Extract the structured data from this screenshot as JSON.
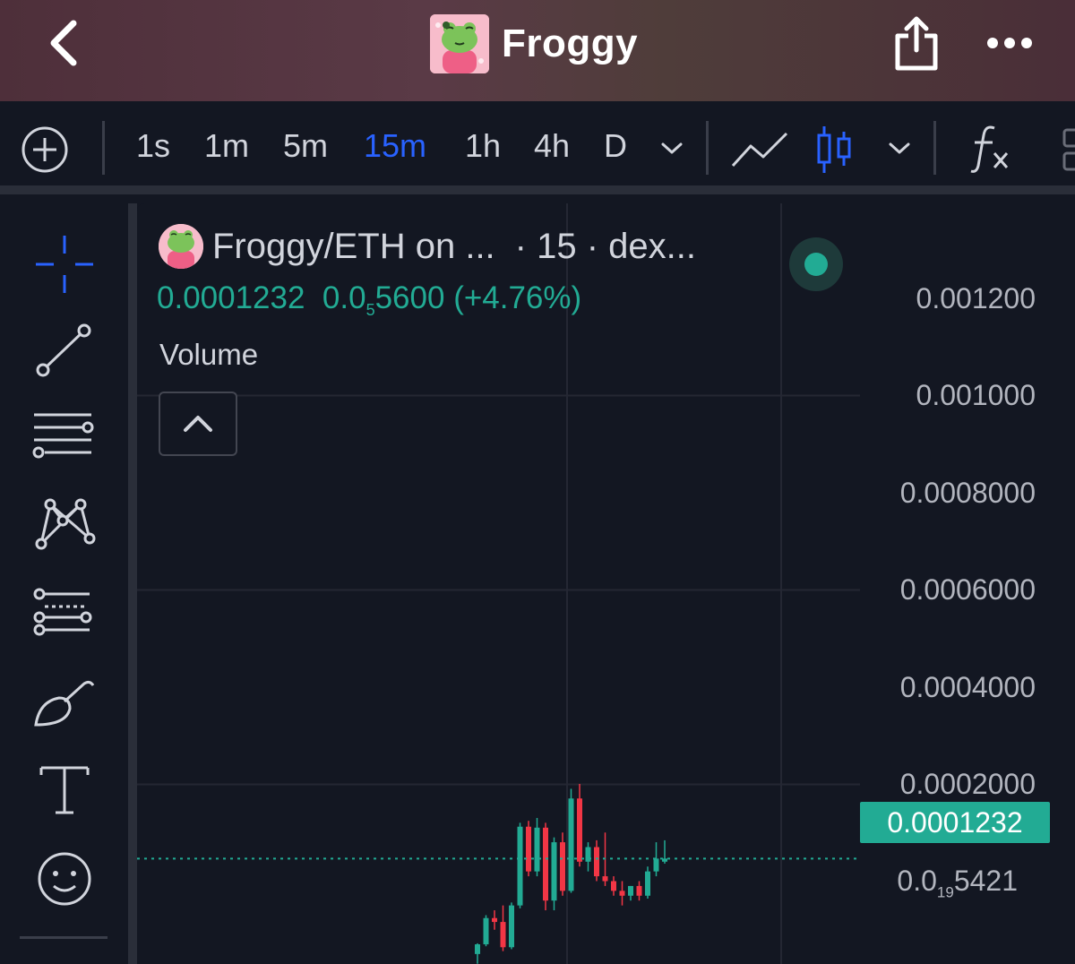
{
  "header": {
    "title": "Froggy",
    "back_icon": "chevron-left-icon",
    "share_icon": "share-icon",
    "more_icon": "more-horizontal-icon"
  },
  "toolbar": {
    "add_icon": "plus-circle-icon",
    "intervals": [
      "1s",
      "1m",
      "5m",
      "15m",
      "1h",
      "4h",
      "D"
    ],
    "active_interval": "15m",
    "line_chart_icon": "line-chart-icon",
    "candle_chart_icon": "candlestick-icon",
    "indicators_icon": "fx-icon"
  },
  "left_tools": [
    {
      "name": "crosshair-icon"
    },
    {
      "name": "trend-line-icon"
    },
    {
      "name": "horizontal-lines-icon"
    },
    {
      "name": "pattern-icon"
    },
    {
      "name": "fib-retracement-icon"
    },
    {
      "name": "brush-icon"
    },
    {
      "name": "text-icon"
    },
    {
      "name": "emoji-icon"
    }
  ],
  "legend": {
    "symbol": "Froggy/ETH on ...",
    "meta": "· 15 · dex...",
    "price": "0.0001232",
    "change_prefix": "0.0",
    "change_sub": "5",
    "change_rest": "5600",
    "change_pct": "(+4.76%)",
    "volume_label": "Volume"
  },
  "price_axis": {
    "labels": [
      "0.001200",
      "0.001000",
      "0.0008000",
      "0.0006000",
      "0.0004000",
      "0.0002000"
    ],
    "last_price": "0.0001232",
    "bottom_prefix": "0.0",
    "bottom_sub": "19",
    "bottom_rest": "5421"
  },
  "colors": {
    "up": "#22ab94",
    "down": "#f23645",
    "accent": "#2962ff",
    "background": "#131722"
  },
  "chart_data": {
    "type": "candlestick",
    "ylim": [
      0,
      0.0013
    ],
    "last_price": 0.0001232,
    "candles": [
      {
        "o": 2.5e-05,
        "h": 3.6e-05,
        "l": 1.5e-05,
        "c": 3.5e-05
      },
      {
        "o": 3.5e-05,
        "h": 6.5e-05,
        "l": 3.3e-05,
        "c": 6.2e-05
      },
      {
        "o": 6.2e-05,
        "h": 7e-05,
        "l": 5e-05,
        "c": 5.8e-05
      },
      {
        "o": 5.8e-05,
        "h": 7.5e-05,
        "l": 2.8e-05,
        "c": 3.2e-05
      },
      {
        "o": 3.2e-05,
        "h": 7.8e-05,
        "l": 3e-05,
        "c": 7.5e-05
      },
      {
        "o": 7.5e-05,
        "h": 0.00016,
        "l": 7.2e-05,
        "c": 0.000156
      },
      {
        "o": 0.000156,
        "h": 0.000162,
        "l": 0.000105,
        "c": 0.00011
      },
      {
        "o": 0.00011,
        "h": 0.000165,
        "l": 0.000105,
        "c": 0.000155
      },
      {
        "o": 0.000155,
        "h": 0.00016,
        "l": 7e-05,
        "c": 8e-05
      },
      {
        "o": 8e-05,
        "h": 0.000145,
        "l": 7e-05,
        "c": 0.00014
      },
      {
        "o": 0.00014,
        "h": 0.00015,
        "l": 8.5e-05,
        "c": 9e-05
      },
      {
        "o": 9e-05,
        "h": 0.000195,
        "l": 8.8e-05,
        "c": 0.000185
      },
      {
        "o": 0.000185,
        "h": 0.0002,
        "l": 0.000115,
        "c": 0.00012
      },
      {
        "o": 0.00012,
        "h": 0.00014,
        "l": 0.00011,
        "c": 0.000135
      },
      {
        "o": 0.000135,
        "h": 0.000142,
        "l": 0.0001,
        "c": 0.000105
      },
      {
        "o": 0.000105,
        "h": 0.00015,
        "l": 9.5e-05,
        "c": 0.0001
      },
      {
        "o": 0.0001,
        "h": 0.000105,
        "l": 8.5e-05,
        "c": 9e-05
      },
      {
        "o": 9e-05,
        "h": 0.0001,
        "l": 7.5e-05,
        "c": 8.5e-05
      },
      {
        "o": 8.5e-05,
        "h": 9.5e-05,
        "l": 8e-05,
        "c": 9.5e-05
      },
      {
        "o": 9.5e-05,
        "h": 0.0001,
        "l": 8e-05,
        "c": 8.5e-05
      },
      {
        "o": 8.5e-05,
        "h": 0.000115,
        "l": 8.2e-05,
        "c": 0.00011
      },
      {
        "o": 0.00011,
        "h": 0.00014,
        "l": 0.000105,
        "c": 0.0001232
      },
      {
        "o": 0.00012,
        "h": 0.000142,
        "l": 0.000118,
        "c": 0.0001232
      }
    ]
  }
}
